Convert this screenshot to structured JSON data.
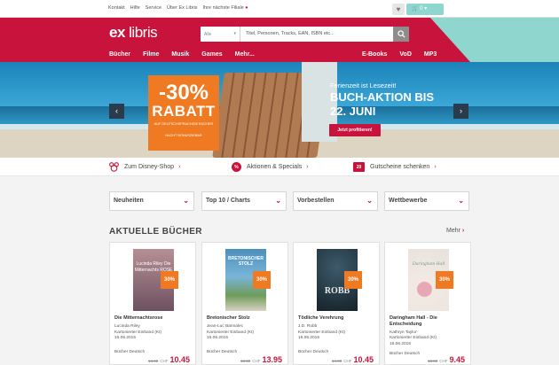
{
  "topbar": {
    "links": [
      "Kontakt",
      "Hilfe",
      "Service",
      "Über Ex Libris",
      "Ihre nächste Filiale"
    ],
    "cart_count": "0"
  },
  "header": {
    "logo_ex": "ex",
    "logo_libris": "libris",
    "search_scope": "Alle",
    "search_placeholder": "Titel, Personen, Tracks, EAN, ISBN etc...",
    "nav_left": [
      "Bücher",
      "Filme",
      "Musik",
      "Games",
      "Mehr..."
    ],
    "nav_right": [
      "E-Books",
      "VoD",
      "MP3"
    ]
  },
  "hero": {
    "discount": "-30%",
    "rabatt": "RABATT",
    "small1": "AUF DEUTSCHSPRACHIGE BÜCHER",
    "small2": "NACHT BONUSZIEBAR",
    "tagline": "Ferienzeit ist Lesezeit!",
    "headline1": "BUCH-AKTION BIS",
    "headline2": "22. JUNI",
    "cta": "Jetzt profitieren!",
    "prev_icon": "chevron-left-icon",
    "next_icon": "chevron-right-icon"
  },
  "promo": {
    "items": [
      {
        "label": "Zum Disney-Shop",
        "icon": "mickey-icon"
      },
      {
        "label": "Aktionen & Specials",
        "icon": "percent-icon"
      },
      {
        "label": "Gutscheine schenken",
        "icon": "gift-card-icon",
        "icon_text": "20"
      }
    ]
  },
  "dropdowns": [
    "Neuheiten",
    "Top 10 / Charts",
    "Vorbestellen",
    "Wettbewerbe"
  ],
  "section": {
    "title": "AKTUELLE BÜCHER",
    "more": "Mehr"
  },
  "books": [
    {
      "title": "Die Mitternachtsrose",
      "author": "Lucinda Riley",
      "binding": "Kartonierter Einband (Kt)",
      "date": "16.06.2015",
      "lang": "Bücher Deutsch",
      "old_price": "14.90",
      "currency": "CHF",
      "price": "10.45",
      "badge": "30%",
      "cover_color": "#8c6a7a",
      "cover_label": "Lucinda Riley Die Mitternachts ROSE"
    },
    {
      "title": "Bretonischer Stolz",
      "author": "Jean-Luc Bannalec",
      "binding": "Kartonierter Einband (Kt)",
      "date": "16.06.2015",
      "lang": "Bücher Deutsch",
      "old_price": "19.90",
      "currency": "CHF",
      "price": "13.95",
      "badge": "30%",
      "cover_color": "#4b8fbd",
      "cover_label": "BRETONISCHER STOLZ"
    },
    {
      "title": "Tödliche Verehrung",
      "author": "J.D. Robb",
      "binding": "Kartonierter Einband (Kt)",
      "date": "16.06.2015",
      "lang": "Bücher Deutsch",
      "old_price": "14.90",
      "currency": "CHF",
      "price": "10.45",
      "badge": "30%",
      "cover_color": "#1c2a33",
      "cover_label": "ROBB"
    },
    {
      "title": "Daringham Hall - Die Entscheidung",
      "author": "Kathryn Taylor",
      "binding": "Kartonierter Einband (Kt)",
      "date": "16.06.2015",
      "lang": "Bücher Deutsch",
      "old_price": "13.50",
      "currency": "CHF",
      "price": "9.45",
      "badge": "30%",
      "cover_color": "#e9e2dc",
      "cover_label": "Daringham Hall"
    }
  ]
}
